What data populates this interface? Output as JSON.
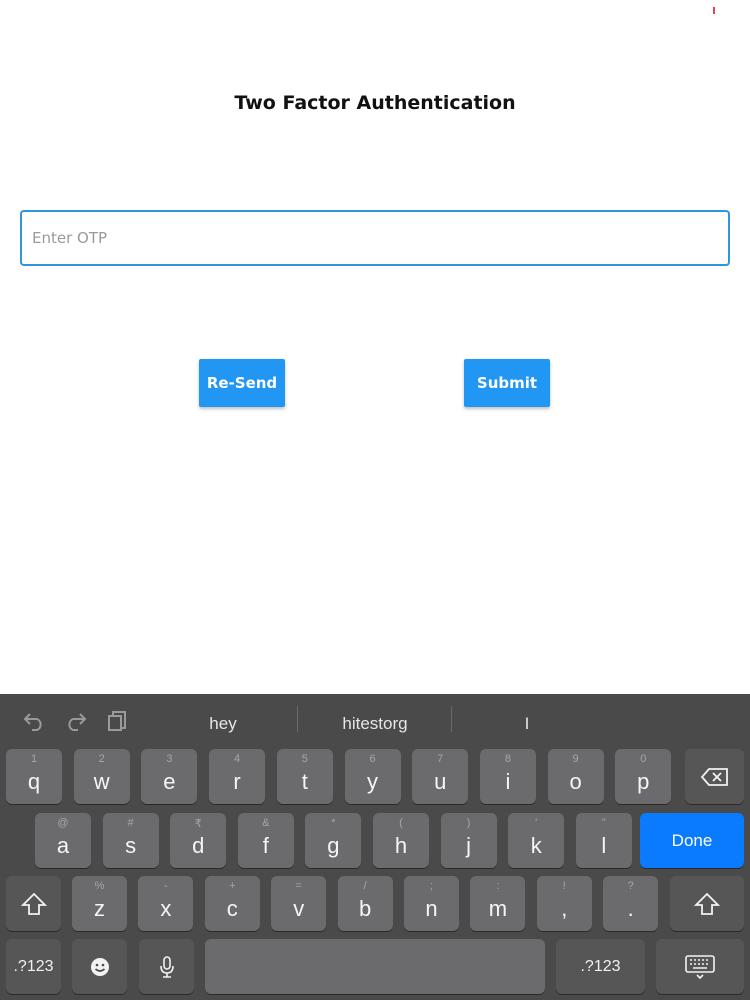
{
  "header": {
    "title": "Two Factor Authentication"
  },
  "otp": {
    "placeholder": "Enter OTP",
    "value": ""
  },
  "buttons": {
    "resend": "Re-Send",
    "submit": "Submit"
  },
  "keyboard": {
    "suggestions": [
      "hey",
      "hitestorg",
      "I"
    ],
    "row1": [
      {
        "hint": "1",
        "main": "q"
      },
      {
        "hint": "2",
        "main": "w"
      },
      {
        "hint": "3",
        "main": "e"
      },
      {
        "hint": "4",
        "main": "r"
      },
      {
        "hint": "5",
        "main": "t"
      },
      {
        "hint": "6",
        "main": "y"
      },
      {
        "hint": "7",
        "main": "u"
      },
      {
        "hint": "8",
        "main": "i"
      },
      {
        "hint": "9",
        "main": "o"
      },
      {
        "hint": "0",
        "main": "p"
      }
    ],
    "row2": [
      {
        "hint": "@",
        "main": "a"
      },
      {
        "hint": "#",
        "main": "s"
      },
      {
        "hint": "₹",
        "main": "d"
      },
      {
        "hint": "&",
        "main": "f"
      },
      {
        "hint": "*",
        "main": "g"
      },
      {
        "hint": "(",
        "main": "h"
      },
      {
        "hint": ")",
        "main": "j"
      },
      {
        "hint": "'",
        "main": "k"
      },
      {
        "hint": "\"",
        "main": "l"
      }
    ],
    "row3": [
      {
        "hint": "%",
        "main": "z"
      },
      {
        "hint": "-",
        "main": "x"
      },
      {
        "hint": "+",
        "main": "c"
      },
      {
        "hint": "=",
        "main": "v"
      },
      {
        "hint": "/",
        "main": "b"
      },
      {
        "hint": ";",
        "main": "n"
      },
      {
        "hint": ":",
        "main": "m"
      },
      {
        "hint": "!",
        "main": ","
      },
      {
        "hint": "?",
        "main": "."
      }
    ],
    "done_label": "Done",
    "numbers_label": ".?123",
    "accent_color": "#0a7aff"
  }
}
